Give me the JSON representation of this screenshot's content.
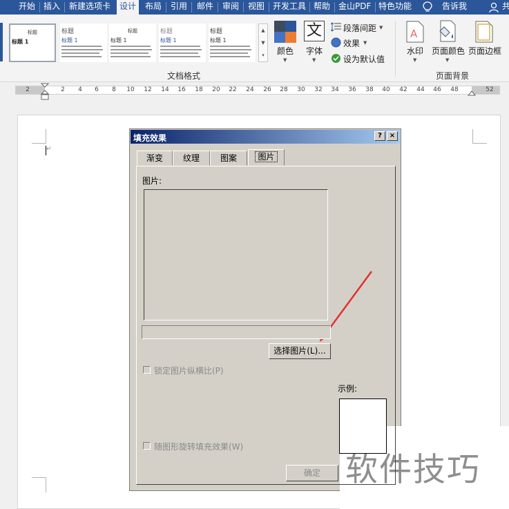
{
  "ribbon": {
    "tabs": [
      "开始",
      "插入",
      "新建选项卡",
      "设计",
      "布局",
      "引用",
      "邮件",
      "审阅",
      "视图",
      "开发工具",
      "帮助",
      "金山PDF",
      "特色功能",
      "告诉我",
      "共"
    ],
    "active_tab": "设计",
    "style_thumbs": [
      {
        "heading": "标题",
        "sub": "标题 1"
      },
      {
        "heading": "标题",
        "sub": "标题 1"
      },
      {
        "heading": "标题",
        "sub": "标题 1"
      },
      {
        "heading": "标题",
        "sub": "标题 1"
      },
      {
        "heading": "标题",
        "sub": "标题 1"
      }
    ],
    "colors_label": "颜色",
    "fonts_label": "字体",
    "fonts_glyph": "文",
    "paragraph_spacing_label": "段落间距",
    "effects_label": "效果",
    "set_default_label": "设为默认值",
    "document_format_group": "文档格式",
    "watermark_label": "水印",
    "page_color_label": "页面颜色",
    "page_border_label": "页面边框",
    "page_background_group": "页面背景"
  },
  "ruler": {
    "numbers": [
      "2",
      "2",
      "4",
      "6",
      "8",
      "10",
      "12",
      "14",
      "16",
      "18",
      "20",
      "22",
      "24",
      "26",
      "28",
      "30",
      "32",
      "34",
      "36",
      "38",
      "40",
      "42",
      "44",
      "46",
      "48",
      "52"
    ]
  },
  "dialog": {
    "title": "填充效果",
    "help_button": "?",
    "close_button": "×",
    "tabs": [
      "渐变",
      "纹理",
      "图案",
      "图片"
    ],
    "active_tab": "图片",
    "picture_label": "图片:",
    "select_picture_button": "选择图片(L)...",
    "lock_aspect_label": "锁定图片纵横比(P)",
    "rotate_with_shape_label": "随图形旋转填充效果(W)",
    "sample_label": "示例:",
    "ok_button": "确定"
  },
  "watermark": {
    "text": "软件技巧"
  },
  "colors": {
    "ribbon_blue": "#2b579a",
    "dialog_gray": "#d4d0c8",
    "arrow_red": "#e03030"
  }
}
